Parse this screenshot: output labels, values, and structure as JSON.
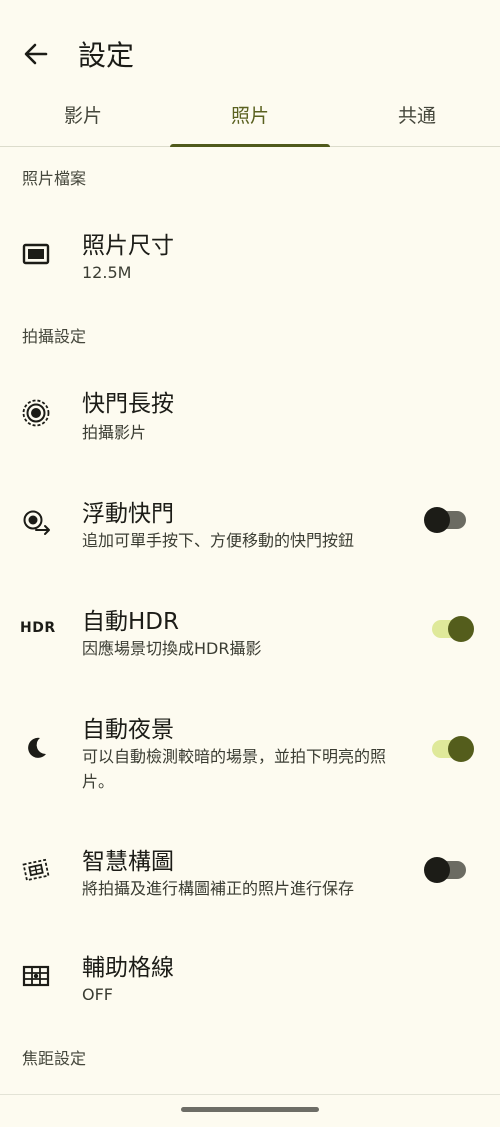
{
  "appbar": {
    "title": "設定"
  },
  "tabs": [
    {
      "label": "影片",
      "active": false
    },
    {
      "label": "照片",
      "active": true
    },
    {
      "label": "共通",
      "active": false
    }
  ],
  "sections": {
    "photo_file": "照片檔案",
    "shooting": "拍攝設定",
    "focus": "焦距設定"
  },
  "rows": {
    "photo_size": {
      "label": "照片尺寸",
      "value": "12.5M",
      "icon": "photo-size-icon"
    },
    "shutter_long_press": {
      "label": "快門長按",
      "value": "拍攝影片",
      "icon": "shutter-icon"
    },
    "floating_shutter": {
      "label": "浮動快門",
      "value": "追加可單手按下、方便移動的快門按鈕",
      "icon": "floating-shutter-icon",
      "toggle": "off"
    },
    "auto_hdr": {
      "label": "自動HDR",
      "value": "因應場景切換成HDR攝影",
      "icon_text": "HDR",
      "toggle": "on"
    },
    "auto_night": {
      "label": "自動夜景",
      "value": "可以自動檢測較暗的場景，並拍下明亮的照片。",
      "icon": "moon-icon",
      "toggle": "on"
    },
    "smart_composition": {
      "label": "智慧構圖",
      "value": "將拍攝及進行構圖補正的照片進行保存",
      "icon": "composition-icon",
      "toggle": "off"
    },
    "grid_lines": {
      "label": "輔助格線",
      "value": "OFF",
      "icon": "grid-icon"
    }
  },
  "colors": {
    "background": "#fdfbf0",
    "accent": "#545d1c",
    "accent_track": "#dfe99a"
  }
}
